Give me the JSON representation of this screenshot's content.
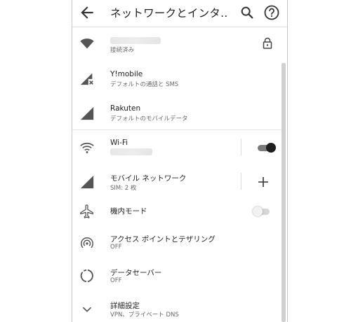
{
  "appbar": {
    "title": "ネットワークとインタ…"
  },
  "wifi_connected": {
    "status": "接続済み"
  },
  "sim_ymobile": {
    "name": "Y!mobile",
    "detail": "デフォルトの通話と SMS"
  },
  "sim_rakuten": {
    "name": "Rakuten",
    "detail": "デフォルトのモバイルデータ"
  },
  "wifi": {
    "label": "Wi-Fi",
    "enabled": true
  },
  "mobile_network": {
    "label": "モバイル ネットワーク",
    "detail": "SIM: 2 枚"
  },
  "airplane": {
    "label": "機内モード",
    "enabled": false
  },
  "hotspot": {
    "label": "アクセス ポイントとテザリング",
    "status": "OFF"
  },
  "data_saver": {
    "label": "データセーバー",
    "status": "OFF"
  },
  "advanced": {
    "label": "詳細設定",
    "detail": "VPN、プライベート DNS"
  },
  "icons": {
    "back": "arrow-back-icon",
    "search": "search-icon",
    "help": "help-icon",
    "wifi_filled": "wifi-filled-icon",
    "lock": "lock-icon",
    "signal_x": "signal-no-service-icon",
    "signal": "signal-icon",
    "wifi_outline": "wifi-outline-icon",
    "add": "add-icon",
    "airplane": "airplane-icon",
    "hotspot": "hotspot-icon",
    "data_saver": "data-saver-icon",
    "expand": "chevron-down-icon"
  },
  "colors": {
    "background": "#ffffff",
    "text_primary": "#202020",
    "text_secondary": "#666666",
    "icon": "#555555",
    "toggle_on": "#1e1e1e",
    "divider": "#dcdcdc"
  }
}
